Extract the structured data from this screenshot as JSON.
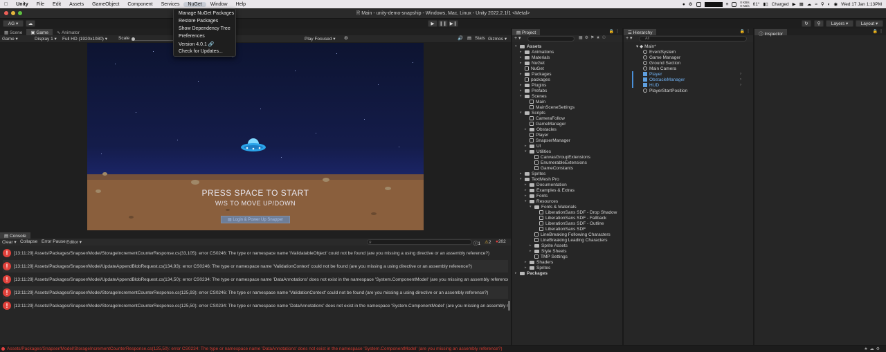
{
  "menubar": {
    "app": "Unity",
    "items": [
      "File",
      "Edit",
      "Assets",
      "GameObject",
      "Component",
      "Services",
      "NuGet",
      "Window",
      "Help"
    ],
    "status_right": {
      "net_up": "0 KB/s",
      "net_down": "0 KB/s",
      "temp": "61°",
      "battery": "Charged",
      "datetime": "Wed 17 Jan  1:13PM"
    }
  },
  "window": {
    "title": "Main - unity-demo-snapship - Windows, Mac, Linux - Unity 2022.2.1f1 <Metal>"
  },
  "toolbar": {
    "account": "AG",
    "layers": "Layers",
    "layout": "Layout"
  },
  "nuget_menu": {
    "items": [
      "Manage NuGet Packages",
      "Restore Packages",
      "Show Dependency Tree",
      "Preferences",
      "Version 4.0.1",
      "Check for Updates..."
    ]
  },
  "scene_tabs": {
    "scene": "Scene",
    "game": "Game",
    "animator": "Animator"
  },
  "game_bar": {
    "view": "Game",
    "display": "Display 1",
    "resolution": "Full HD (1920x1080)",
    "scale": "Scale",
    "play_focused": "Play Focused",
    "stats": "Stats",
    "gizmos": "Gizmos"
  },
  "game": {
    "press": "PRESS SPACE TO START",
    "move": "W/S TO MOVE UP/DOWN",
    "login": "Login & Power Up Snapper"
  },
  "console": {
    "tab": "Console",
    "clear": "Clear",
    "collapse": "Collapse",
    "error_pause": "Error Pause",
    "editor": "Editor",
    "counts": {
      "info": "1",
      "warn": "2",
      "error": "202"
    },
    "rows": [
      "[13:11:29] Assets/Packages/Snapser/Model/StorageIncrementCounterResponse.cs(33,105): error CS0246: The type or namespace name 'IValidatableObject' could not be found (are you missing a using directive or an assembly reference?)",
      "[13:11:29] Assets/Packages/Snapser/Model/UpdateAppendBlobRequest.cs(134,93): error CS0246: The type or namespace name 'ValidationContext' could not be found (are you missing a using directive or an assembly reference?)",
      "[13:11:29] Assets/Packages/Snapser/Model/UpdateAppendBlobRequest.cs(134,50): error CS0234: The type or namespace name 'DataAnnotations' does not exist in the namespace 'System.ComponentModel' (are you missing an assembly reference?)",
      "[13:11:29] Assets/Packages/Snapser/Model/StorageIncrementCounterResponse.cs(125,93): error CS0246: The type or namespace name 'ValidationContext' could not be found (are you missing a using directive or an assembly reference?)",
      "[13:11:29] Assets/Packages/Snapser/Model/StorageIncrementCounterResponse.cs(125,50): error CS0234: The type or namespace name 'DataAnnotations' does not exist in the namespace 'System.ComponentModel' (are you missing an assembly reference?)"
    ]
  },
  "project": {
    "tab": "Project",
    "tree": [
      {
        "label": "Assets",
        "depth": 0,
        "kind": "folder",
        "open": true,
        "bold": true
      },
      {
        "label": "Animations",
        "depth": 1,
        "kind": "folder"
      },
      {
        "label": "Materials",
        "depth": 1,
        "kind": "folder"
      },
      {
        "label": "NuGet",
        "depth": 1,
        "kind": "folder"
      },
      {
        "label": "NuGet",
        "depth": 1,
        "kind": "file"
      },
      {
        "label": "Packages",
        "depth": 1,
        "kind": "folder"
      },
      {
        "label": "packages",
        "depth": 1,
        "kind": "file"
      },
      {
        "label": "Plugins",
        "depth": 1,
        "kind": "folder"
      },
      {
        "label": "Prefabs",
        "depth": 1,
        "kind": "folder"
      },
      {
        "label": "Scenes",
        "depth": 1,
        "kind": "folder",
        "open": true
      },
      {
        "label": "Main",
        "depth": 2,
        "kind": "file"
      },
      {
        "label": "MainSceneSettings",
        "depth": 2,
        "kind": "file"
      },
      {
        "label": "Scripts",
        "depth": 1,
        "kind": "folder",
        "open": true
      },
      {
        "label": "CameraFollow",
        "depth": 2,
        "kind": "cs"
      },
      {
        "label": "GameManager",
        "depth": 2,
        "kind": "file"
      },
      {
        "label": "Obstacles",
        "depth": 2,
        "kind": "folder"
      },
      {
        "label": "Player",
        "depth": 2,
        "kind": "cs"
      },
      {
        "label": "SnapserManager",
        "depth": 2,
        "kind": "cs"
      },
      {
        "label": "UI",
        "depth": 2,
        "kind": "folder"
      },
      {
        "label": "Utilities",
        "depth": 2,
        "kind": "folder",
        "open": true
      },
      {
        "label": "CanvasGroupExtensions",
        "depth": 3,
        "kind": "cs"
      },
      {
        "label": "EnumerableExtensions",
        "depth": 3,
        "kind": "cs"
      },
      {
        "label": "GameConstants",
        "depth": 3,
        "kind": "cs"
      },
      {
        "label": "Sprites",
        "depth": 1,
        "kind": "folder"
      },
      {
        "label": "TextMesh Pro",
        "depth": 1,
        "kind": "folder",
        "open": true
      },
      {
        "label": "Documentation",
        "depth": 2,
        "kind": "folder"
      },
      {
        "label": "Examples & Extras",
        "depth": 2,
        "kind": "folder"
      },
      {
        "label": "Fonts",
        "depth": 2,
        "kind": "folder"
      },
      {
        "label": "Resources",
        "depth": 2,
        "kind": "folder",
        "open": true
      },
      {
        "label": "Fonts & Materials",
        "depth": 3,
        "kind": "folder",
        "open": true
      },
      {
        "label": "LiberationSans SDF - Drop Shadow",
        "depth": 4,
        "kind": "file"
      },
      {
        "label": "LiberationSans SDF - Fallback",
        "depth": 4,
        "kind": "file"
      },
      {
        "label": "LiberationSans SDF - Outline",
        "depth": 4,
        "kind": "file"
      },
      {
        "label": "LiberationSans SDF",
        "depth": 4,
        "kind": "file"
      },
      {
        "label": "LineBreaking Following Characters",
        "depth": 3,
        "kind": "file"
      },
      {
        "label": "LineBreaking Leading Characters",
        "depth": 3,
        "kind": "file"
      },
      {
        "label": "Sprite Assets",
        "depth": 3,
        "kind": "folder"
      },
      {
        "label": "Style Sheets",
        "depth": 3,
        "kind": "folder"
      },
      {
        "label": "TMP Settings",
        "depth": 3,
        "kind": "file"
      },
      {
        "label": "Shaders",
        "depth": 2,
        "kind": "folder"
      },
      {
        "label": "Sprites",
        "depth": 2,
        "kind": "folder"
      },
      {
        "label": "Packages",
        "depth": 0,
        "kind": "folder",
        "bold": true
      }
    ]
  },
  "hierarchy": {
    "tab": "Hierarchy",
    "search_placeholder": "All",
    "items": [
      {
        "label": "Main*",
        "depth": 0,
        "kind": "scene"
      },
      {
        "label": "EventSystem",
        "depth": 1,
        "kind": "go"
      },
      {
        "label": "Game Manager",
        "depth": 1,
        "kind": "go"
      },
      {
        "label": "Ground Section",
        "depth": 1,
        "kind": "go"
      },
      {
        "label": "Main Camera",
        "depth": 1,
        "kind": "go"
      },
      {
        "label": "Player",
        "depth": 1,
        "kind": "prefab"
      },
      {
        "label": "ObstacleManager",
        "depth": 1,
        "kind": "prefab"
      },
      {
        "label": "HUD",
        "depth": 1,
        "kind": "prefab"
      },
      {
        "label": "PlayerStartPosition",
        "depth": 1,
        "kind": "go"
      }
    ]
  },
  "inspector": {
    "tab": "Inspector"
  },
  "status_bar": {
    "text": "Assets/Packages/Snapser/Model/StorageIncrementCounterResponse.cs(125,50): error CS0234: The type or namespace name 'DataAnnotations' does not exist in the namespace 'System.ComponentModel' (are you missing an assembly reference?)"
  }
}
